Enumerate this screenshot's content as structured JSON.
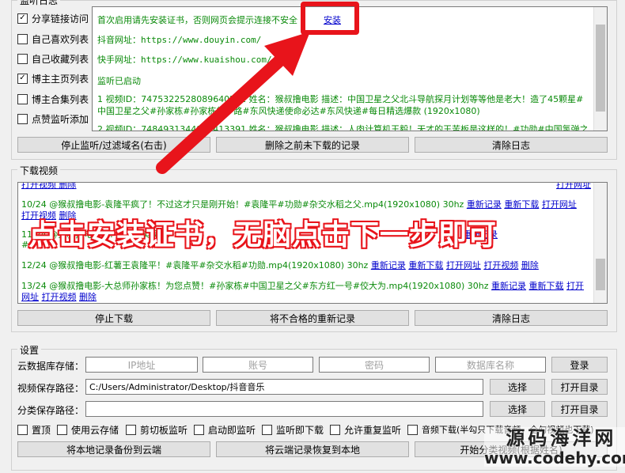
{
  "monitor": {
    "title": "监听日志",
    "options": [
      {
        "label": "分享链接访问",
        "checked": true
      },
      {
        "label": "自己喜欢列表",
        "checked": false
      },
      {
        "label": "自己收藏列表",
        "checked": false
      },
      {
        "label": "博主主页列表",
        "checked": true
      },
      {
        "label": "博主合集列表",
        "checked": false
      },
      {
        "label": "点赞监听添加",
        "checked": false
      }
    ],
    "log": {
      "notice": "首次启用请先安装证书，否则网页会提示连接不安全",
      "install_label": "安装",
      "douyin_label": "抖音网址：",
      "douyin_url": "https://www.douyin.com/",
      "kuaishou_label": "快手网址：",
      "kuaishou_url": "https://www.kuaishou.com/",
      "started": "监听已启动",
      "entry1_a": "1  视频ID：7475322528089640201  姓名：猴叔撸电影  描述：中国卫星之父北斗导航探月计划等等他是老大！造了45颗星#",
      "entry1_b": "中国卫星之父#孙家栋#孙家栋的一路#东风快递使命必达#东风快递#每日精选爆款  (1920x1080)",
      "entry2": "2  视频ID：7484931344893413391  姓名：猴叔撸电影  描述：人肉计算机王毅！天才的王苦板是这样的！#功勋#中国氢弹之"
    },
    "buttons": {
      "stop_filter": "停止监听/过滤域名(右击)",
      "delete_before": "删除之前未下载的记录",
      "clear_log": "清除日志"
    }
  },
  "download": {
    "title": "下载视频",
    "top_partial": "打开视频  删除",
    "top_partial2": "打开网址",
    "rows": [
      {
        "text": "10/24  @猴叔撸电影-袁隆平疯了！不过这才只是刚开始！#袁隆平#功勋#杂交水稻之父.mp4(1920x1080)  30hz",
        "links": [
          "重新记录",
          "重新下载",
          "打开网址"
        ],
        "wrap_links": [
          "打开视频",
          "删除"
        ]
      },
      {
        "text": "11/24  @猴叔撸电影-...  能用AI实现  ...",
        "links": [
          "重新记录"
        ],
        "wrap_links": []
      },
      {
        "text": "12/24  @猴叔撸电影-红薯王袁隆平！#袁隆平#杂交水稻#功勋.mp4(1920x1080)  30hz",
        "links": [
          "重新记录",
          "重新下载",
          "打开网址",
          "打开视频",
          "删除"
        ],
        "wrap_links": []
      },
      {
        "text": "13/24  @猴叔撸电影-大总师孙家栋！为您点赞！#孙家栋#中国卫星之父#东方红一号#佼大为.mp4(1920x1080)  30hz",
        "links": [
          "重新记录",
          "重新下载",
          "打开"
        ],
        "wrap_links": [
          "网址",
          "打开视频",
          "删除"
        ]
      }
    ],
    "row11_line2": "#",
    "buttons": {
      "stop": "停止下载",
      "rerecord": "将不合格的重新记录",
      "clear": "清除日志"
    }
  },
  "settings": {
    "title": "设置",
    "cloud_label": "云数据库存储：",
    "ip_placeholder": "IP地址",
    "account_placeholder": "账号",
    "password_placeholder": "密码",
    "dbname_placeholder": "数据库名称",
    "login_label": "登录",
    "video_path_label": "视频保存路径：",
    "video_path_value": "C:/Users/Administrator/Desktop/抖音音乐",
    "choose_label": "选择",
    "open_dir_label": "打开目录",
    "category_path_label": "分类保存路径：",
    "category_path_value": "",
    "options": [
      {
        "label": "置顶",
        "checked": false
      },
      {
        "label": "使用云存储",
        "checked": false
      },
      {
        "label": "剪切板监听",
        "checked": false
      },
      {
        "label": "启动即监听",
        "checked": false
      },
      {
        "label": "监听即下载",
        "checked": false
      },
      {
        "label": "允许重复监听",
        "checked": false
      },
      {
        "label": "音频下载(半勾只下载音频，全勾视频也下载)",
        "checked": false
      }
    ],
    "buttons": {
      "backup": "将本地记录备份到云端",
      "restore": "将云端记录恢复到本地",
      "start_classify": "开始分类视频(根据姓名)"
    }
  },
  "overlay": {
    "caption": "点击安装证书，无脑点击下一步即可",
    "watermark_cn": "源码海洋网",
    "watermark_url": "www.codehy.com",
    "accent": "#e8141b"
  }
}
